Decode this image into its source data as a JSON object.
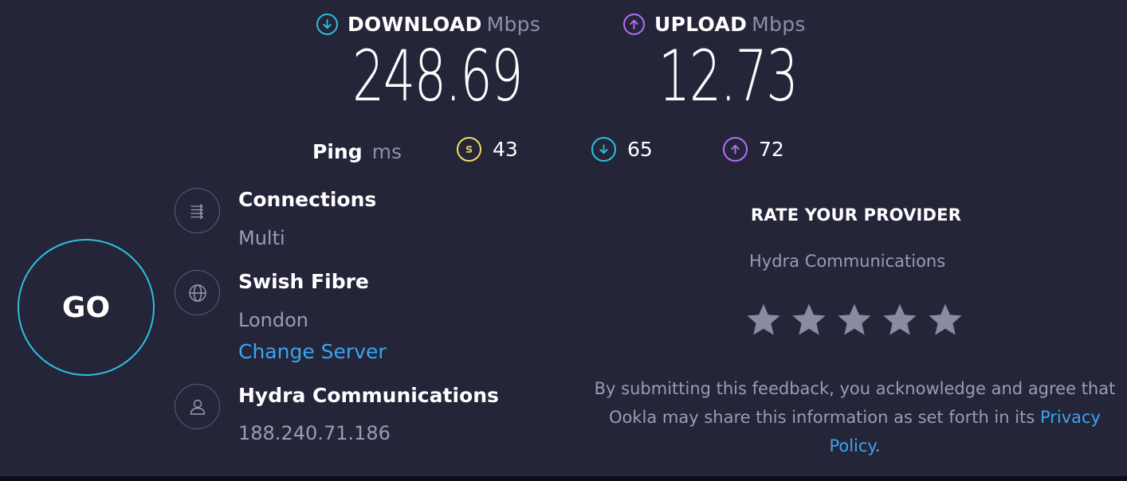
{
  "download": {
    "label": "DOWNLOAD",
    "unit": "Mbps",
    "value": "248.69",
    "color": "#2dc0d8",
    "icon": "arrow-down-circle"
  },
  "upload": {
    "label": "UPLOAD",
    "unit": "Mbps",
    "value": "12.73",
    "color": "#b26ff5",
    "icon": "arrow-up-circle"
  },
  "ping": {
    "label": "Ping",
    "unit": "ms",
    "idle": {
      "value": "43",
      "color": "#f2df5b",
      "icon": "idle-latency-icon"
    },
    "download": {
      "value": "65",
      "color": "#2dc0d8",
      "icon": "arrow-down-circle"
    },
    "upload": {
      "value": "72",
      "color": "#b26ff5",
      "icon": "arrow-up-circle"
    }
  },
  "go_button": {
    "label": "GO",
    "color": "#2dc0d8"
  },
  "connections": {
    "title": "Connections",
    "value": "Multi",
    "icon": "connections-icon"
  },
  "server": {
    "name": "Swish Fibre",
    "location": "London",
    "change_label": "Change Server",
    "icon": "globe-icon"
  },
  "provider": {
    "name": "Hydra Communications",
    "ip": "188.240.71.186",
    "icon": "user-icon"
  },
  "rating": {
    "title": "RATE YOUR PROVIDER",
    "provider_name": "Hydra Communications",
    "stars": 5,
    "disclaimer_before": "By submitting this feedback, you acknowledge and agree that Ookla may share this information as set forth in its ",
    "privacy_link": "Privacy Policy",
    "disclaimer_after": "."
  },
  "colors": {
    "background": "#25253a",
    "link": "#3aa5f0",
    "muted": "#9a9cb2",
    "star": "#8a8ba0"
  }
}
